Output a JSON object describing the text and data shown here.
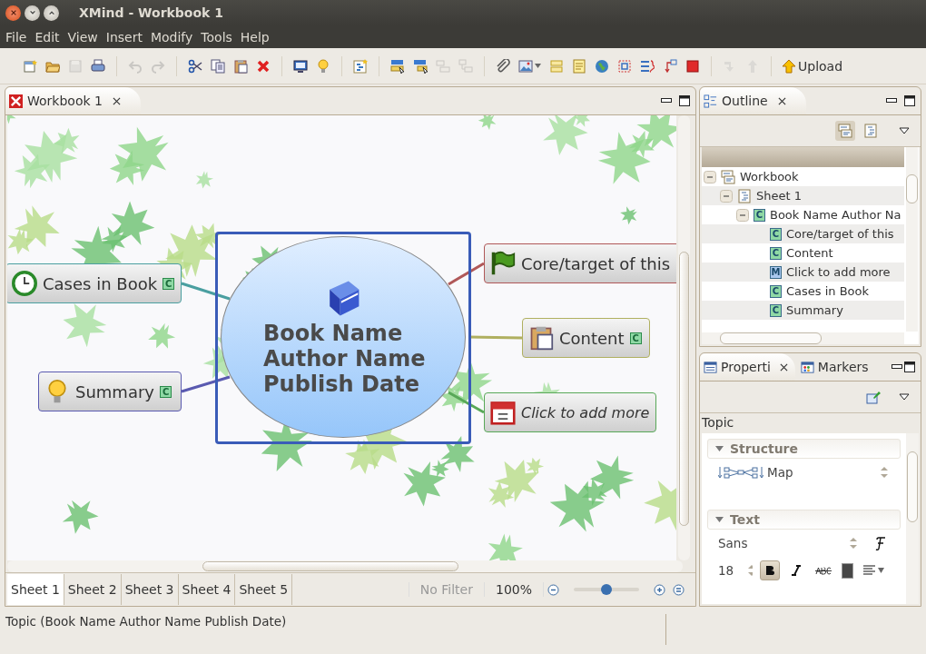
{
  "window": {
    "title": "XMind - Workbook 1"
  },
  "menu": [
    "File",
    "Edit",
    "View",
    "Insert",
    "Modify",
    "Tools",
    "Help"
  ],
  "toolbar": {
    "groups": [
      [
        {
          "kind": "new-file",
          "disabled": false
        },
        {
          "kind": "folder",
          "disabled": false
        },
        {
          "kind": "floppy",
          "disabled": true
        },
        {
          "kind": "printer",
          "disabled": false
        }
      ],
      [
        {
          "kind": "undo",
          "disabled": true
        },
        {
          "kind": "redo",
          "disabled": true
        }
      ],
      [
        {
          "kind": "scissors",
          "disabled": false
        },
        {
          "kind": "copy",
          "disabled": false
        },
        {
          "kind": "clipboard",
          "disabled": false
        },
        {
          "kind": "delete",
          "disabled": false
        }
      ],
      [
        {
          "kind": "monitor",
          "disabled": false
        },
        {
          "kind": "bulb",
          "disabled": false
        }
      ],
      [
        {
          "kind": "sheet-star",
          "disabled": false
        }
      ],
      [
        {
          "kind": "topic-cursor",
          "disabled": false
        },
        {
          "kind": "subtopic-cursor",
          "disabled": false
        },
        {
          "kind": "before-topic",
          "disabled": true
        },
        {
          "kind": "parent-topic",
          "disabled": true
        }
      ],
      [
        {
          "kind": "paperclip",
          "disabled": false
        },
        {
          "kind": "image",
          "disabled": false
        },
        {
          "kind": "boundary",
          "disabled": false
        },
        {
          "kind": "note",
          "disabled": false
        },
        {
          "kind": "globe",
          "disabled": false
        },
        {
          "kind": "frame",
          "disabled": false
        },
        {
          "kind": "brace",
          "disabled": false
        },
        {
          "kind": "relationship",
          "disabled": false
        },
        {
          "kind": "stop",
          "disabled": false
        }
      ],
      [
        {
          "kind": "down-arrow",
          "disabled": true
        },
        {
          "kind": "up-arrow",
          "disabled": true
        }
      ]
    ],
    "upload": "Upload"
  },
  "editor": {
    "tab": "Workbook 1",
    "central_topic": {
      "lines": [
        "Book Name",
        "Author Name",
        "Publish Date"
      ],
      "selected": true
    },
    "branches": [
      {
        "text": "Cases in Book",
        "marker": "C",
        "italic": false,
        "color": "#4a9fa0"
      },
      {
        "text": "Summary",
        "marker": "C",
        "italic": false,
        "color": "#5a5ab0"
      },
      {
        "text": "Core/target of this",
        "italic": false,
        "color": "#b05858"
      },
      {
        "text": "Content",
        "marker": "C",
        "italic": false,
        "color": "#b0b060"
      },
      {
        "text": "Click to add more",
        "italic": true,
        "color": "#58a858"
      }
    ],
    "sheets": [
      {
        "label": "Sheet 1",
        "selected": true
      },
      {
        "label": "Sheet 2",
        "selected": false
      },
      {
        "label": "Sheet 3",
        "selected": false
      },
      {
        "label": "Sheet 4",
        "selected": false
      },
      {
        "label": "Sheet 5",
        "selected": false
      }
    ],
    "filter": "No Filter",
    "zoom": "100%",
    "zoom_slider": {
      "level": 0.5
    }
  },
  "outline": {
    "tab": "Outline",
    "tree": [
      {
        "label": "Workbook",
        "expanded": true,
        "children": [
          {
            "label": "Sheet 1",
            "expanded": true,
            "children": [
              {
                "label": "Book Name Author Na",
                "marker": "C",
                "color": "#8fd9a5",
                "expanded": true,
                "children": [
                  {
                    "label": "Core/target of this",
                    "marker": "C",
                    "color": "#8fd9a5"
                  },
                  {
                    "label": "Content",
                    "marker": "C",
                    "color": "#8fd9a5"
                  },
                  {
                    "label": "Click to add more",
                    "marker": "M",
                    "color": "#a9c8ee"
                  },
                  {
                    "label": "Cases in Book",
                    "marker": "C",
                    "color": "#8fd9a5"
                  },
                  {
                    "label": "Summary",
                    "marker": "C",
                    "color": "#8fd9a5"
                  }
                ]
              }
            ]
          }
        ]
      }
    ]
  },
  "properties": {
    "tabs": [
      {
        "label": "Properti",
        "selected": true
      },
      {
        "label": "Markers",
        "selected": false
      }
    ],
    "heading": "Topic",
    "structure": {
      "title": "Structure",
      "expanded": true,
      "value": "Map"
    },
    "text": {
      "title": "Text",
      "expanded": true,
      "font": "Sans",
      "size": "18",
      "bold": true,
      "italic": false,
      "strikethrough": false,
      "color": "#474747"
    }
  },
  "status_bar": "Topic (Book Name Author Name Publish Date)"
}
